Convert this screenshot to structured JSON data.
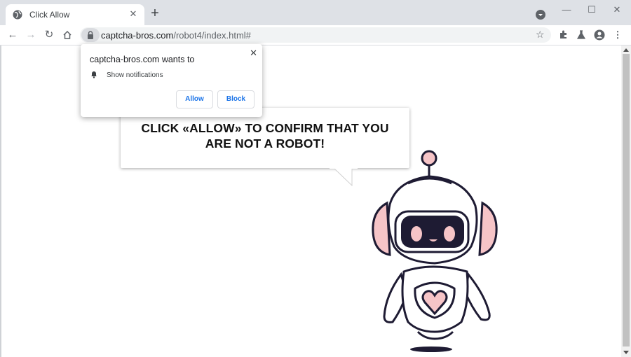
{
  "browser": {
    "tab": {
      "title": "Click Allow",
      "close_glyph": "✕"
    },
    "newtab_glyph": "+",
    "window_controls": {
      "minimize": "—",
      "maximize": "☐",
      "close": "✕"
    },
    "nav": {
      "back": "←",
      "forward": "→",
      "reload": "↻"
    },
    "url": {
      "domain": "captcha-bros.com",
      "path": "/robot4/index.html#"
    }
  },
  "permission_popup": {
    "title": "captcha-bros.com wants to",
    "permission": "Show notifications",
    "allow_label": "Allow",
    "block_label": "Block",
    "close_glyph": "✕"
  },
  "page": {
    "message_line1": "CLICK «ALLOW» TO CONFIRM THAT YOU",
    "message_line2": "ARE NOT A ROBOT!"
  },
  "colors": {
    "accent_blue": "#1a73e8",
    "robot_outline": "#1e1b33",
    "robot_pink": "#f6c4c7",
    "tabstrip": "#dee1e6"
  }
}
